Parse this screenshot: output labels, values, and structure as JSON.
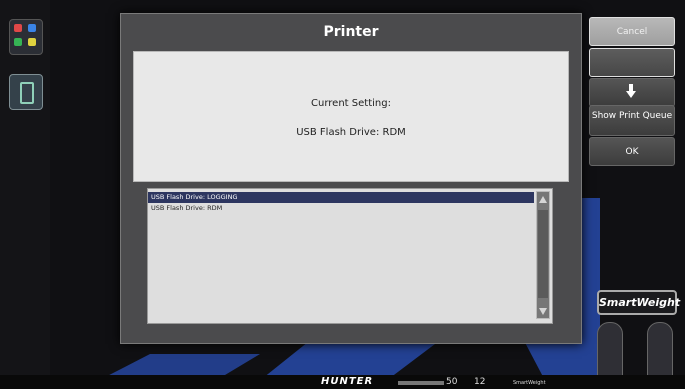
{
  "dialog": {
    "title": "Printer",
    "current_setting_label": "Current Setting:",
    "current_setting_value": "USB Flash Drive: RDM",
    "options": [
      {
        "label": "USB Flash Drive: LOGGING",
        "selected": true
      },
      {
        "label": "USB Flash Drive: RDM",
        "selected": false
      }
    ]
  },
  "side_buttons": {
    "cancel": "Cancel",
    "show_print_queue": "Show Print Queue",
    "ok": "OK"
  },
  "branding": {
    "product": "HUNTER",
    "smartweight": "SmartWeight",
    "status_a": "50",
    "status_b": "12",
    "smartweight_small": "SmartWeight"
  },
  "icons": {
    "grid": "apps-grid-icon",
    "tire": "tire-icon",
    "scroll_up": "chevron-up-icon",
    "scroll_down": "chevron-down-icon",
    "down": "arrow-down-icon"
  },
  "colors": {
    "selection": "#2d3660",
    "dialog": "#4b4b4d",
    "watermark": "#294fb7"
  }
}
